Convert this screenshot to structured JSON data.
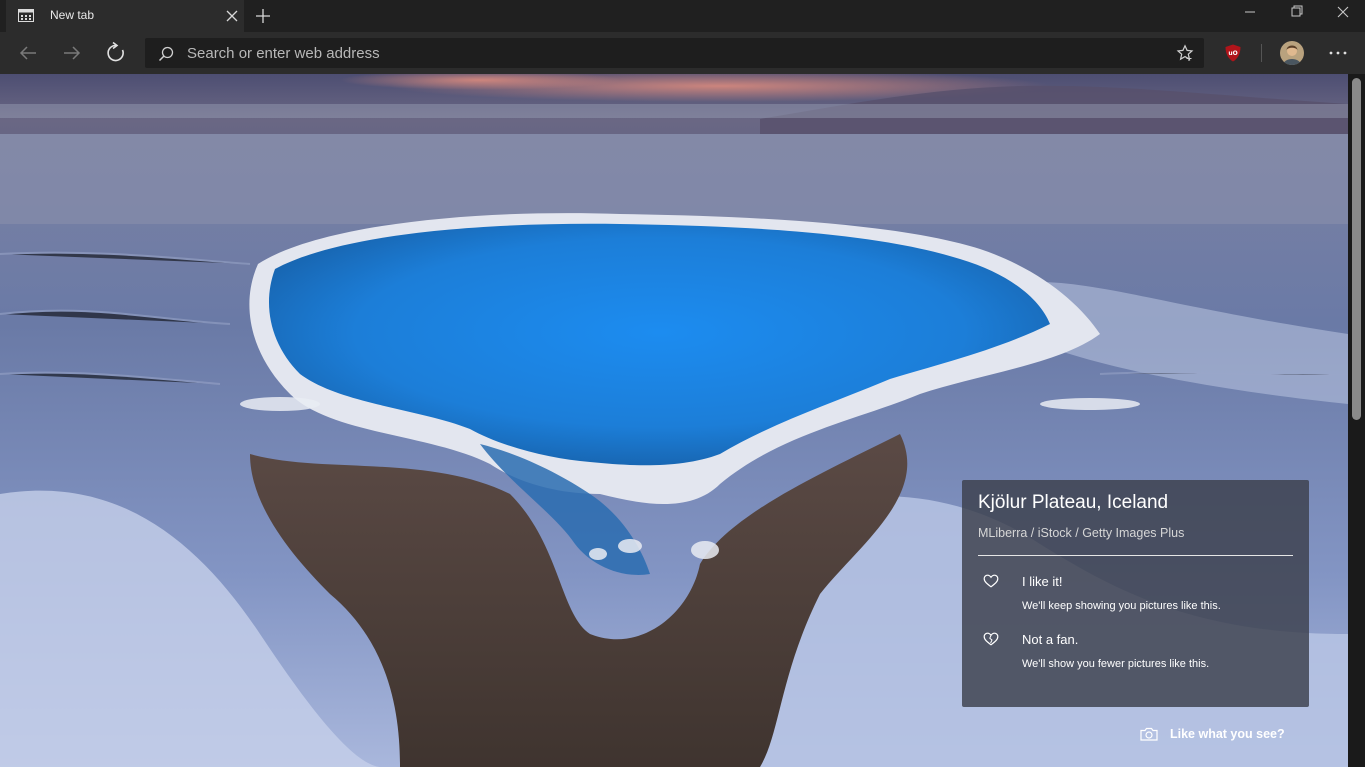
{
  "tab": {
    "title": "New tab",
    "close_icon": "close-icon",
    "favicon": "newtab-page-icon"
  },
  "toolbar": {
    "back_icon": "arrow-left-icon",
    "forward_icon": "arrow-right-icon",
    "refresh_icon": "refresh-icon",
    "address_placeholder": "Search or enter web address",
    "favorite_icon": "star-outline-icon",
    "extension": {
      "name": "uBlock Origin",
      "badge": "uO"
    },
    "more_icon": "more-horizontal-icon"
  },
  "window_controls": [
    "minimize",
    "restore",
    "close"
  ],
  "background": {
    "location": "Kjölur Plateau, Iceland",
    "credit": "MLiberra / iStock / Getty Images Plus"
  },
  "feedback": {
    "like_label": "I like it!",
    "like_desc": "We'll keep showing you pictures like this.",
    "dislike_label": "Not a fan.",
    "dislike_desc": "We'll show you fewer pictures like this.",
    "cta": "Like what you see?"
  },
  "colors": {
    "accent_blue": "#1f8fe0",
    "tab_bg": "#2c2c2c",
    "chrome_bg": "#202020",
    "card_bg": "#3c404c"
  }
}
